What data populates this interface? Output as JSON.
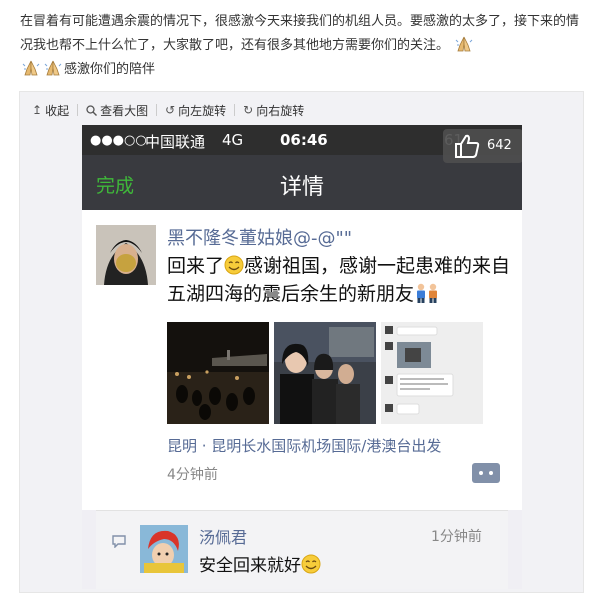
{
  "post": {
    "text_part1": "在冒着有可能遭遇余震的情况下，很感激今天来接我们的机组人员。要感激的太多了，接下来的情况我也帮不上什么忙了，大家散了吧，还有很多其他地方需要你们的关注。",
    "text_part2": "感激你们的陪伴"
  },
  "toolbar": {
    "collapse_label": "收起",
    "view_large_label": "查看大图",
    "rotate_left_label": "向左旋转",
    "rotate_right_label": "向右旋转",
    "icons": [
      "collapse-arrow-icon",
      "magnifier-icon",
      "rotate-left-icon",
      "rotate-right-icon"
    ]
  },
  "phone": {
    "status": {
      "signal": "●●●○○",
      "carrier": "中国联通",
      "network": "4G",
      "time": "06:46",
      "battery_partial": "61"
    },
    "nav": {
      "done_label": "完成",
      "title": "详情"
    },
    "like_badge": {
      "count": "642"
    },
    "moment": {
      "author": "黑不隆冬董姑娘@-@\"\"",
      "content_pre": "回来了",
      "content_post": "感谢祖国，感谢一起患难的来自五湖四海的震后余生的新朋友",
      "location": "昆明 · 昆明长水国际机场国际/港澳台出发",
      "time": "4分钟前",
      "photo_count": 3
    },
    "comment": {
      "author": "汤佩君",
      "time": "1分钟前",
      "text": "安全回来就好"
    }
  },
  "colors": {
    "link_blue": "#576b95",
    "wechat_green": "#3fb83a",
    "nav_dark": "#393a3f",
    "status_dark": "#2e2e2e"
  }
}
